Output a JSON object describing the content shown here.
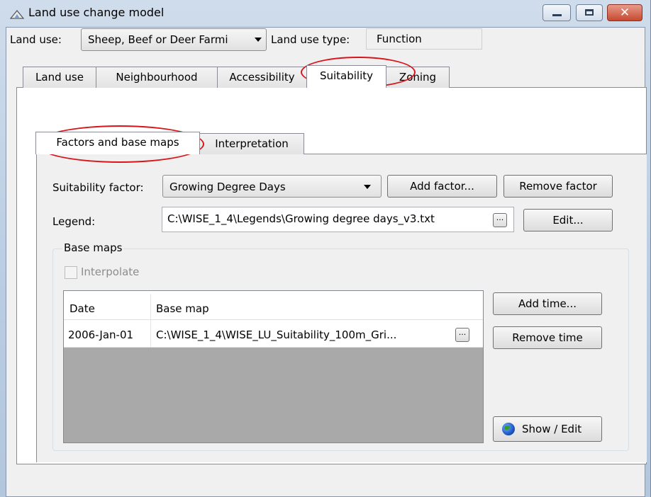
{
  "window": {
    "title": "Land use change model",
    "controls": {
      "minimize": "minimize",
      "maximize": "maximize",
      "close": "✕"
    }
  },
  "top_row": {
    "land_use_label": "Land use:",
    "land_use_value": "Sheep, Beef or Deer Farmi",
    "land_use_type_label": "Land use type:",
    "land_use_type_value": "Function"
  },
  "main_tabs": [
    {
      "label": "Land use",
      "active": false
    },
    {
      "label": "Neighbourhood",
      "active": false
    },
    {
      "label": "Accessibility",
      "active": false
    },
    {
      "label": "Suitability",
      "active": true
    },
    {
      "label": "Zoning",
      "active": false
    }
  ],
  "sub_tabs": [
    {
      "label": "Factors and base maps",
      "active": true
    },
    {
      "label": "Interpretation",
      "active": false
    }
  ],
  "suitability": {
    "factor_label": "Suitability factor:",
    "factor_value": "Growing Degree Days",
    "add_factor_label": "Add factor...",
    "remove_factor_label": "Remove factor",
    "legend_label": "Legend:",
    "legend_value": "C:\\WISE_1_4\\Legends\\Growing degree days_v3.txt",
    "browse_label": "...",
    "edit_label": "Edit..."
  },
  "base_maps": {
    "group_title": "Base maps",
    "interpolate_label": "Interpolate",
    "interpolate_checked": false,
    "columns": [
      "Date",
      "Base map"
    ],
    "rows": [
      {
        "date": "2006-Jan-01",
        "base_map": "C:\\WISE_1_4\\WISE_LU_Suitability_100m_Gri..."
      }
    ],
    "add_time_label": "Add time...",
    "remove_time_label": "Remove time",
    "show_edit_label": "Show / Edit"
  },
  "colors": {
    "highlight_ring": "#d8151b",
    "empty_grid": "#a9a9a9",
    "panel_bg": "#f0f0f0"
  }
}
